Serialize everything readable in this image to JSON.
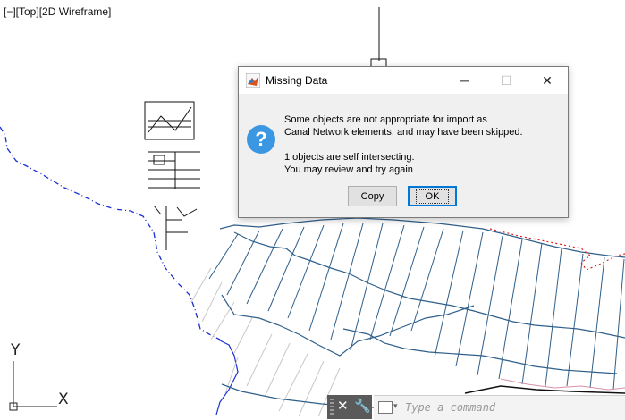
{
  "viewport": {
    "label": "[−][Top][2D Wireframe]"
  },
  "ucs": {
    "y_label": "Y",
    "x_label": "X"
  },
  "dialog": {
    "title": "Missing Data",
    "message_line1": "Some objects are not appropriate for import as",
    "message_line2": "Canal Network elements, and may have been skipped.",
    "message_line3": "1 objects are self intersecting.",
    "message_line4": "You may review and try again",
    "copy_label": "Copy",
    "ok_label": "OK",
    "minimize_glyph": "─",
    "maximize_glyph": "☐",
    "close_glyph": "✕",
    "question_glyph": "?"
  },
  "command_line": {
    "placeholder": "Type a command",
    "close_glyph": "✕",
    "wrench_glyph": "🔧",
    "caret_glyph": "▾"
  },
  "colors": {
    "canal_lines": "#2f5f8a",
    "boundary_blue": "#1a2fd0",
    "boundary_red": "#e02020",
    "hatch_gray": "#c8c8c8",
    "info_blue": "#3c97e3",
    "ok_border": "#0078d7"
  }
}
